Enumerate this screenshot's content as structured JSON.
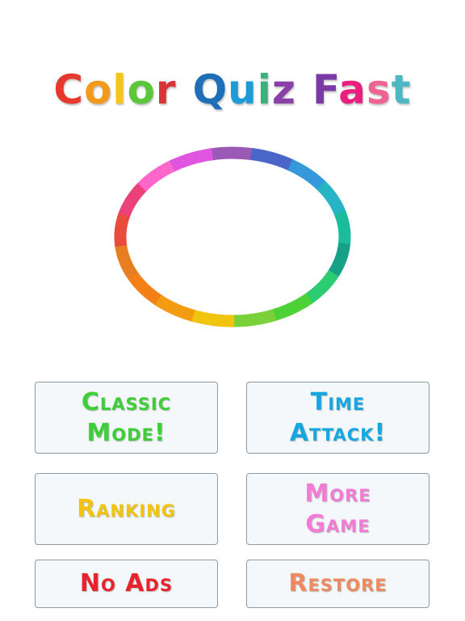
{
  "title": {
    "word1": "Color",
    "word2": "Quiz",
    "word3": "Fast",
    "letter_colors": [
      "#e5392e",
      "#f29a1b",
      "#f7c51a",
      "#5cc63a",
      "#d9333a",
      "#1f6fb8",
      "#1e9ad6",
      "#3ab07a",
      "#8b3fa8",
      "#7a3aa6",
      "#e91e7d",
      "#f06292",
      "#4cb8c4",
      "#d63a6a"
    ]
  },
  "ring": {
    "segment_colors": [
      "#9b59b6",
      "#4a66c8",
      "#3498db",
      "#27b5c6",
      "#1abc9c",
      "#16a085",
      "#2ecc71",
      "#4cd137",
      "#7bd13a",
      "#f1c40f",
      "#f39c12",
      "#f57f17",
      "#e67e22",
      "#e74c3c",
      "#ec407a",
      "#ff66cc",
      "#e055e0"
    ]
  },
  "buttons": {
    "classic": {
      "line1": "Classic",
      "line2": "Mode!",
      "color": "#3fce3a"
    },
    "time_attack": {
      "line1": "Time",
      "line2": "Attack!",
      "color": "#16a7e0"
    },
    "ranking": {
      "label": "Ranking",
      "color": "#f2c40f"
    },
    "more_game": {
      "line1": "More",
      "line2": "Game",
      "color": "#f27bd6"
    },
    "no_ads": {
      "label": "No Ads",
      "color": "#e8232b"
    },
    "restore": {
      "label": "Restore",
      "color": "#ee8a5f"
    }
  }
}
